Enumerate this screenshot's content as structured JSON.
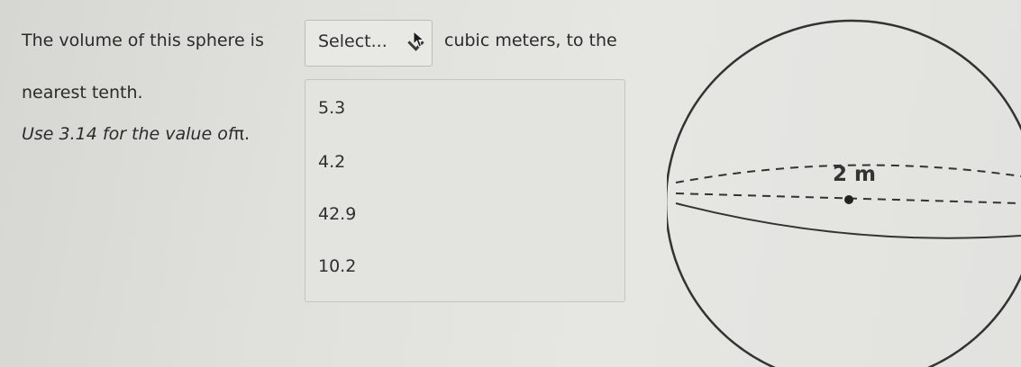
{
  "question": {
    "prefix": "The volume of this sphere is",
    "suffix": "cubic meters, to the",
    "line2": "nearest tenth.",
    "pi_hint_text": "Use 3.14 for the value of",
    "pi_symbol": "π."
  },
  "select": {
    "placeholder": "Select..."
  },
  "dropdown": {
    "options": [
      "5.3",
      "4.2",
      "42.9",
      "10.2"
    ]
  },
  "figure": {
    "radius_label": "2 m"
  },
  "icons": {
    "select_chevron": "chevron-down-icon",
    "mouse_pointer": "cursor-icon"
  }
}
